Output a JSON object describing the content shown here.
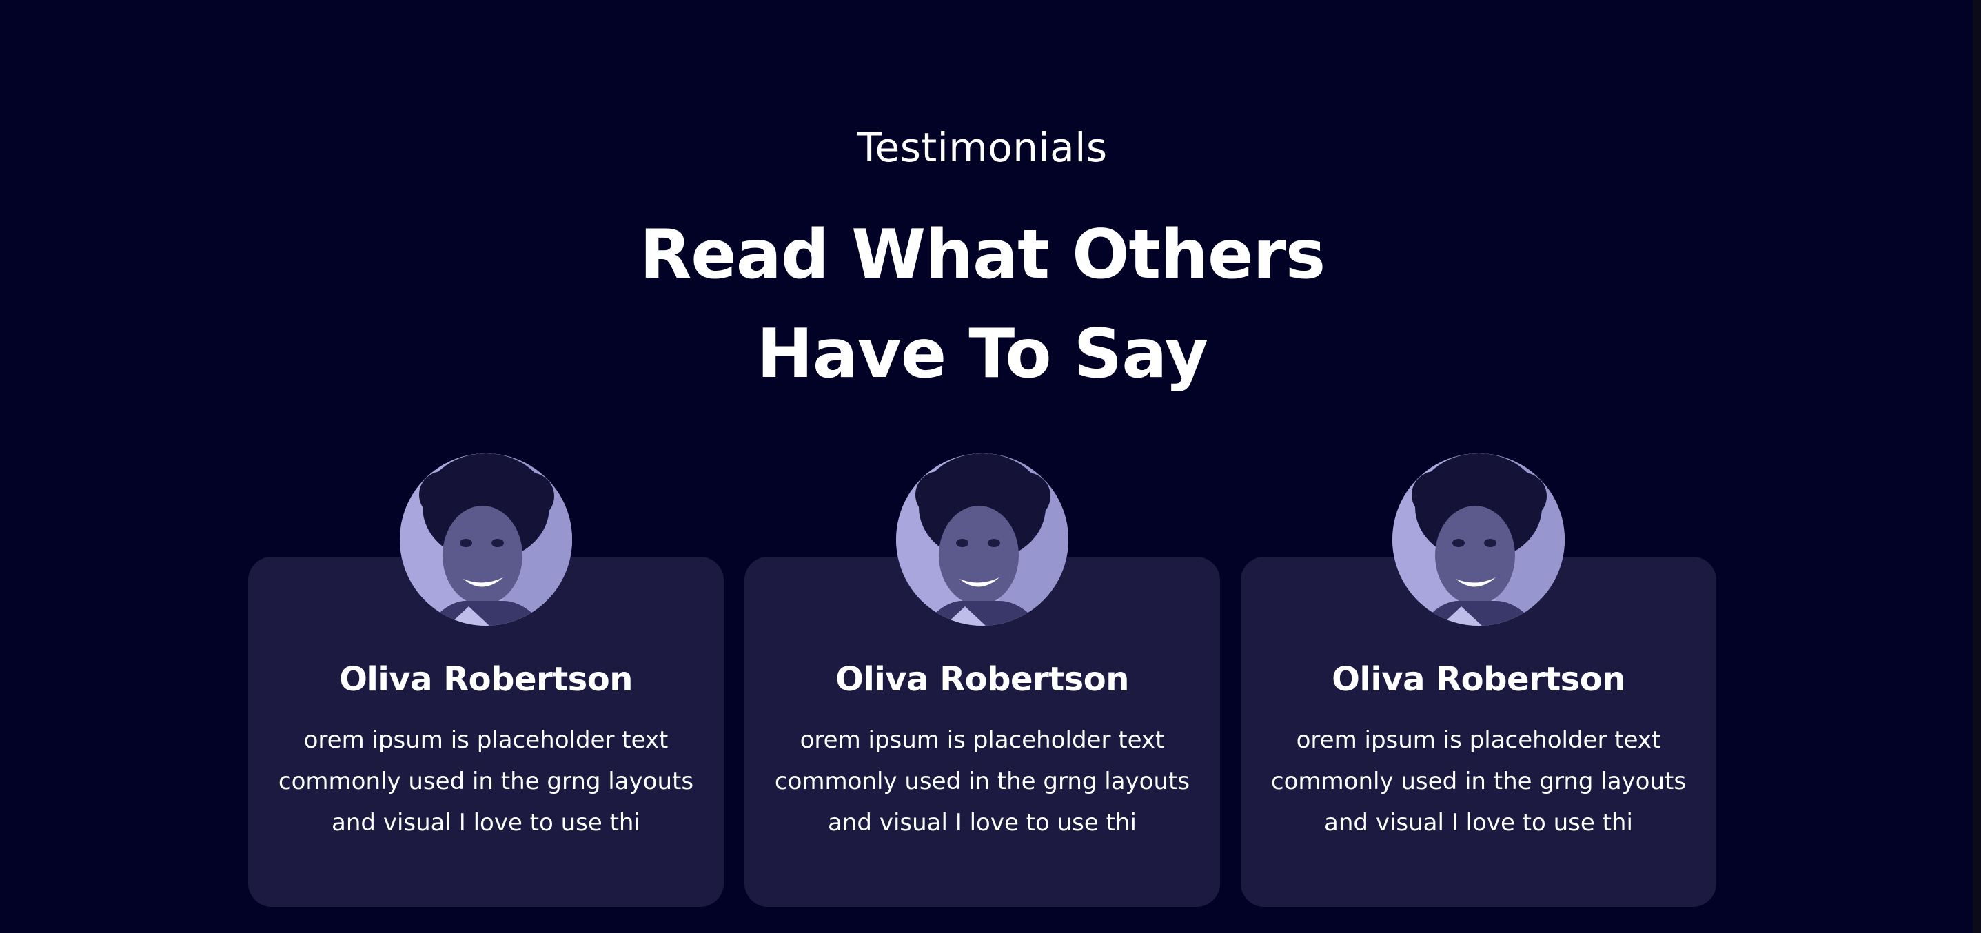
{
  "section": {
    "eyebrow": "Testimonials",
    "heading_line1": "Read What Others",
    "heading_line2": "Have To Say"
  },
  "testimonials": [
    {
      "name": "Oliva Robertson",
      "quote_lines": [
        "orem ipsum is placeholder text",
        "commonly used in the grng layouts",
        "and visual I love to use thi"
      ],
      "avatar_icon": "person-photo"
    },
    {
      "name": "Oliva Robertson",
      "quote_lines": [
        "orem ipsum is placeholder text",
        "commonly used in the grng layouts",
        "and visual I love to use thi"
      ],
      "avatar_icon": "person-photo"
    },
    {
      "name": "Oliva Robertson",
      "quote_lines": [
        "orem ipsum is placeholder text",
        "commonly used in the grng layouts",
        "and visual I love to use thi"
      ],
      "avatar_icon": "person-photo"
    }
  ],
  "colors": {
    "background": "#020226",
    "card": "#1c1a41",
    "avatar_tint": "#a8a6dc",
    "text": "#ffffff"
  }
}
